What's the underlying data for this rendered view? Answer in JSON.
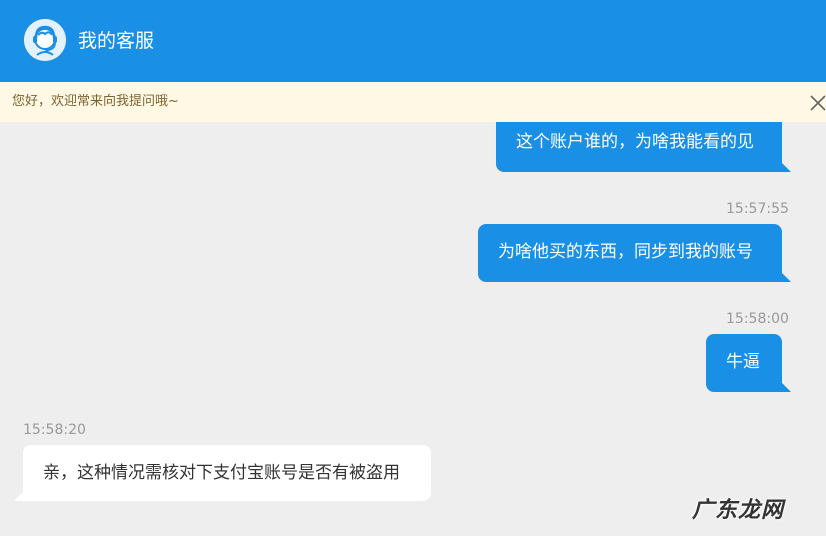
{
  "header": {
    "title": "我的客服",
    "avatar_icon": "customer-service-headset-icon",
    "color": "#1a8fe6"
  },
  "notice": {
    "text": "您好，欢迎常来向我提问哦~",
    "close_icon": "close-icon"
  },
  "messages": [
    {
      "side": "out",
      "text": "这个账户谁的，为啥我能看的见"
    },
    {
      "side": "out",
      "time": "15:57:55",
      "text": "为啥他买的东西，同步到我的账号"
    },
    {
      "side": "out",
      "time": "15:58:00",
      "text": "牛逼"
    },
    {
      "side": "in",
      "time": "15:58:20",
      "text": "亲，这种情况需核对下支付宝账号是否有被盗用"
    }
  ],
  "watermark": {
    "text": "广东龙网"
  }
}
